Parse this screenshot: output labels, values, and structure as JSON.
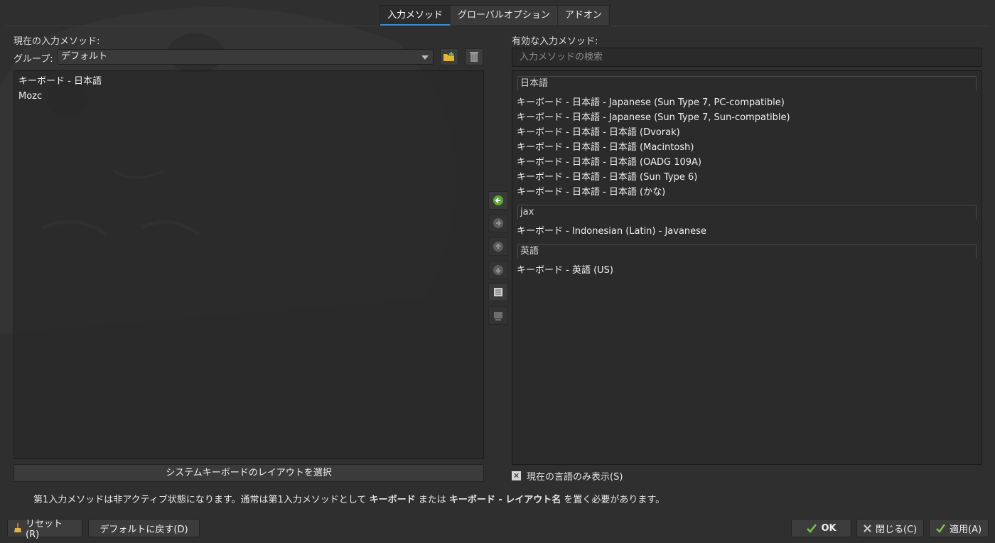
{
  "tabs": [
    {
      "label": "入力メソッド",
      "active": true
    },
    {
      "label": "グローバルオプション",
      "active": false
    },
    {
      "label": "アドオン",
      "active": false
    }
  ],
  "left": {
    "title": "現在の入力メソッド:",
    "group_label": "グループ:",
    "group_value": "デフォルト",
    "items": [
      "キーボード - 日本語",
      "Mozc"
    ],
    "layout_button": "システムキーボードのレイアウトを選択"
  },
  "warning": {
    "prefix": "第1入力メソッドは非アクティブ状態になります。通常は第1入力メソッドとして ",
    "bold1": "キーボード",
    "middle": " または ",
    "bold2": "キーボード - レイアウト名",
    "suffix": " を置く必要があります。"
  },
  "right": {
    "title": "有効な入力メソッド:",
    "search_placeholder": "入力メソッドの検索",
    "groups": [
      {
        "name": "日本語",
        "items": [
          "キーボード - 日本語 - Japanese (Sun Type 7, PC-compatible)",
          "キーボード - 日本語 - Japanese (Sun Type 7, Sun-compatible)",
          "キーボード - 日本語 - 日本語 (Dvorak)",
          "キーボード - 日本語 - 日本語 (Macintosh)",
          "キーボード - 日本語 - 日本語 (OADG 109A)",
          "キーボード - 日本語 - 日本語 (Sun Type 6)",
          "キーボード - 日本語 - 日本語 (かな)"
        ]
      },
      {
        "name": "jax",
        "items": [
          "キーボード - Indonesian (Latin) - Javanese"
        ]
      },
      {
        "name": "英語",
        "items": [
          "キーボード - 英語 (US)"
        ]
      }
    ],
    "show_current_only_label": "現在の言語のみ表示(S)",
    "show_current_only_checked": true
  },
  "bottom": {
    "reset": "リセット(R)",
    "defaults": "デフォルトに戻す(D)",
    "ok": "OK",
    "close": "閉じる(C)",
    "apply": "適用(A)"
  },
  "colors": {
    "background": "#2f2f2f",
    "accent": "#3d8fd6",
    "add_arrow": "#5aa636"
  }
}
